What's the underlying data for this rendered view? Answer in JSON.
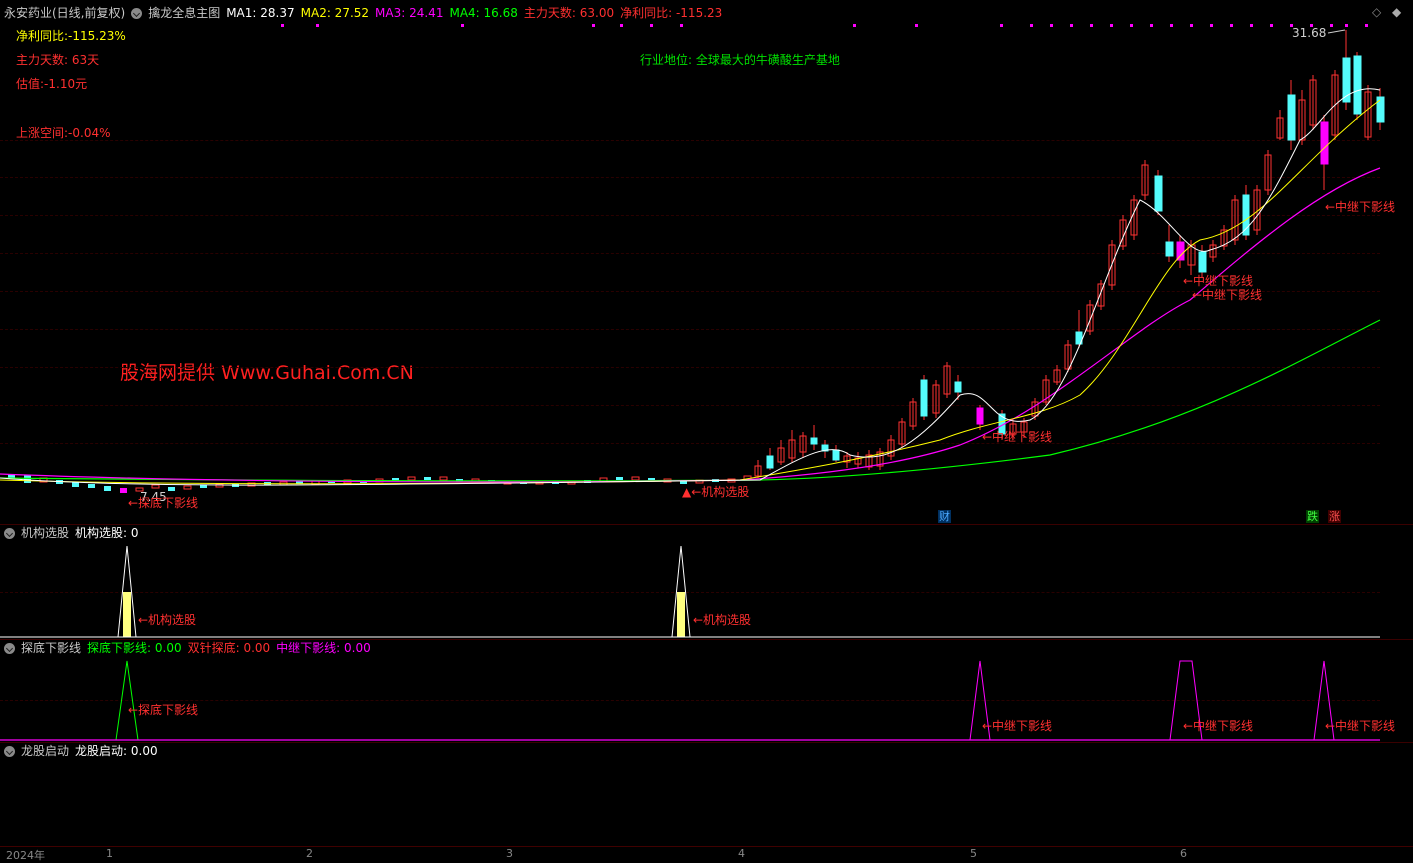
{
  "main_header": {
    "stock_name": "永安药业(日线,前复权)",
    "indicator_name": "擒龙全息主图",
    "ma1": "MA1: 28.37",
    "ma2": "MA2: 27.52",
    "ma3": "MA3: 24.41",
    "ma4": "MA4: 16.68",
    "main_days": "主力天数: 63.00",
    "net_profit": "净利同比: -115.23",
    "colors": {
      "ma1": "#ffffff",
      "ma2": "#ffff00",
      "ma3": "#ff00ff",
      "ma4": "#00ff00",
      "red": "#ff3030"
    }
  },
  "info_panel": {
    "net_profit_yoy": "净利同比:-115.23%",
    "main_days": "主力天数: 63天",
    "valuation": "估值:-1.10元",
    "upside": "上涨空间:-0.04%",
    "industry": "行业地位: 全球最大的牛磺酸生产基地"
  },
  "watermark": "股海网提供 Www.Guhai.Com.CN",
  "price_labels": {
    "high": "31.68",
    "low": "7.45"
  },
  "annotations": {
    "lower_shadow": "←中继下影线",
    "inst_pick": "←机构选股",
    "inst_pick_main": "▲←机构选股",
    "bottom_lower": "←探底下影线",
    "low_overlap": "←探底下影线"
  },
  "badges": {
    "cai": "财",
    "die": "跌",
    "zhang": "涨"
  },
  "panel_inst": {
    "name": "机构选股",
    "value": "机构选股: 0",
    "label": "←机构选股"
  },
  "panel_bottom": {
    "name": "探底下影线",
    "v1": "探底下影线: 0.00",
    "v2": "双针探底: 0.00",
    "v3": "中继下影线: 0.00",
    "label_bottom": "←探底下影线",
    "label_mid": "←中继下影线"
  },
  "panel_dragon": {
    "name": "龙股启动",
    "value": "龙股启动: 0.00"
  },
  "time_axis": [
    "2024年",
    "1",
    "2",
    "3",
    "4",
    "5",
    "6"
  ],
  "window_controls": {
    "diamond_hollow": "◇",
    "diamond_solid": "◆"
  }
}
